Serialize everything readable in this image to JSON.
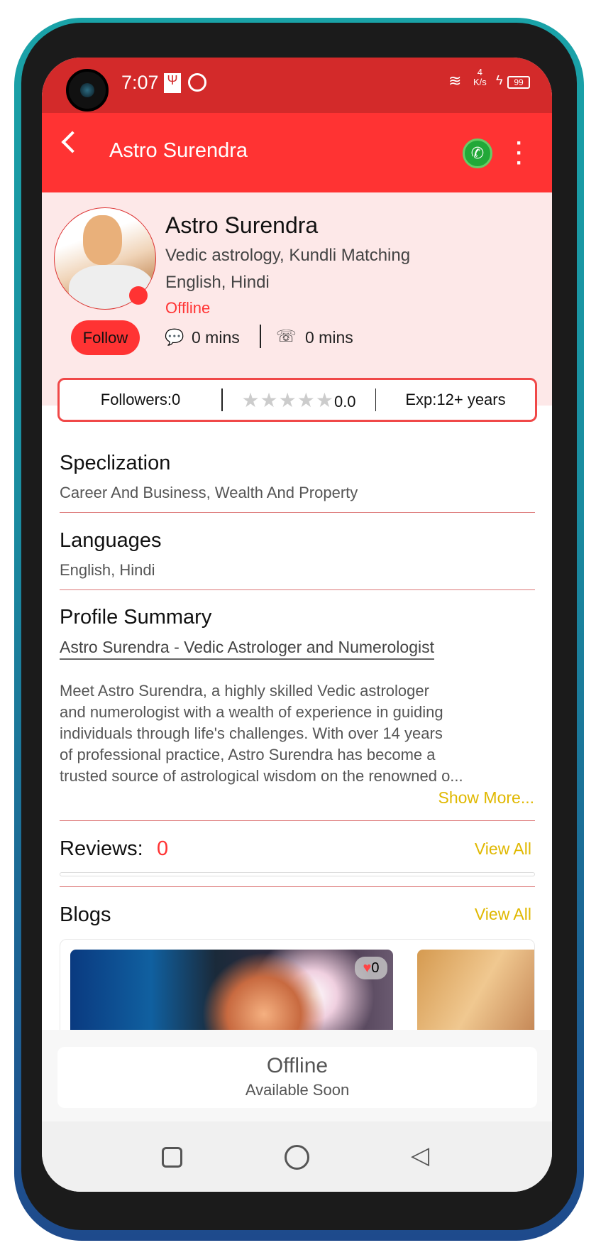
{
  "status_bar": {
    "time": "7:07",
    "net_speed_value": "4",
    "net_speed_unit": "K/s",
    "battery": "99"
  },
  "app_bar": {
    "title": "Astro Surendra",
    "icons": [
      "back-arrow-icon",
      "whatsapp-icon",
      "more-vert-icon"
    ]
  },
  "profile": {
    "name": "Astro Surendra",
    "skills": "Vedic astrology, Kundli Matching",
    "languages": "English, Hindi",
    "status": "Offline",
    "follow_label": "Follow",
    "chat_time": "0 mins",
    "call_time": "0 mins",
    "status_color": "#ff3333"
  },
  "stats": {
    "followers_label": "Followers:",
    "followers": "0",
    "rating": 0.0,
    "rating_text": "0.0",
    "exp_label": "Exp:",
    "exp": "12+ years",
    "max_stars": 5
  },
  "specialization": {
    "title": "Speclization",
    "value": "Career And Business, Wealth And Property"
  },
  "languages": {
    "title": "Languages",
    "value": "English, Hindi"
  },
  "summary": {
    "title": "Profile Summary",
    "headline": "Astro Surendra - Vedic Astrologer and Numerologist",
    "lines": [
      "Meet Astro Surendra, a highly skilled Vedic astrologer",
      "and numerologist with a wealth of experience in guiding",
      "individuals through life's challenges. With over 14 years",
      "of professional practice, Astro Surendra has become a",
      "trusted source of astrological wisdom on the renowned o..."
    ],
    "show_more": "Show More..."
  },
  "reviews": {
    "title": "Reviews:",
    "count": "0",
    "view_all": "View All"
  },
  "blogs": {
    "title": "Blogs",
    "view_all": "View All",
    "items": [
      {
        "likes": "0"
      }
    ]
  },
  "bottom": {
    "status": "Offline",
    "subtitle": "Available Soon"
  },
  "colors": {
    "accent": "#ff3333",
    "status_bar": "#d32a2a",
    "link": "#e0b800",
    "profile_bg": "#fde8e8"
  }
}
